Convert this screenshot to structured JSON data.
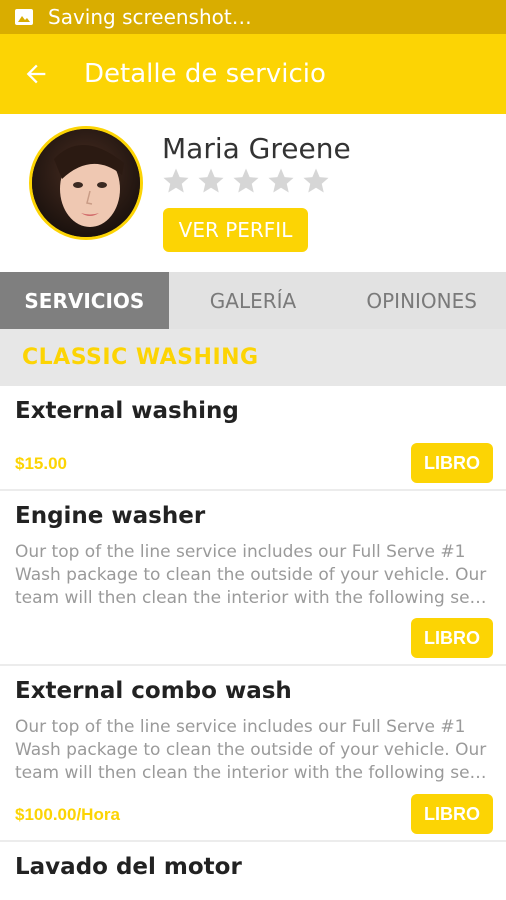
{
  "status_bar": {
    "text": "Saving screenshot…"
  },
  "app_bar": {
    "title": "Detalle de servicio",
    "back_icon": "arrow-back-icon"
  },
  "profile": {
    "name": "Maria Greene",
    "rating": 0,
    "max_rating": 5,
    "button_label": "VER PERFIL"
  },
  "tabs": [
    {
      "label": "SERVICIOS",
      "active": true
    },
    {
      "label": "GALERÍA",
      "active": false
    },
    {
      "label": "OPINIONES",
      "active": false
    }
  ],
  "category": {
    "title": "CLASSIC WASHING"
  },
  "services": [
    {
      "title": "External washing",
      "description": [],
      "price": "$15.00",
      "button_label": "LIBRO"
    },
    {
      "title": "Engine washer",
      "description": [
        "Our top of the line service includes our Full Serve #1",
        "Wash package to clean the outside of your vehicle. Our",
        "team will then clean the interior with the following servi…"
      ],
      "price": "",
      "button_label": "LIBRO"
    },
    {
      "title": "External combo wash",
      "description": [
        "Our top of the line service includes our Full Serve #1",
        "Wash package to clean the outside of your vehicle. Our",
        "team will then clean the interior with the following servi…"
      ],
      "price": "$100.00/Hora",
      "button_label": "LIBRO"
    },
    {
      "title": "Lavado del motor",
      "description": [],
      "price": "",
      "button_label": ""
    }
  ],
  "colors": {
    "accent": "#fcd404",
    "status_bar": "#d9ad00",
    "tab_active": "#7f7f7f"
  }
}
